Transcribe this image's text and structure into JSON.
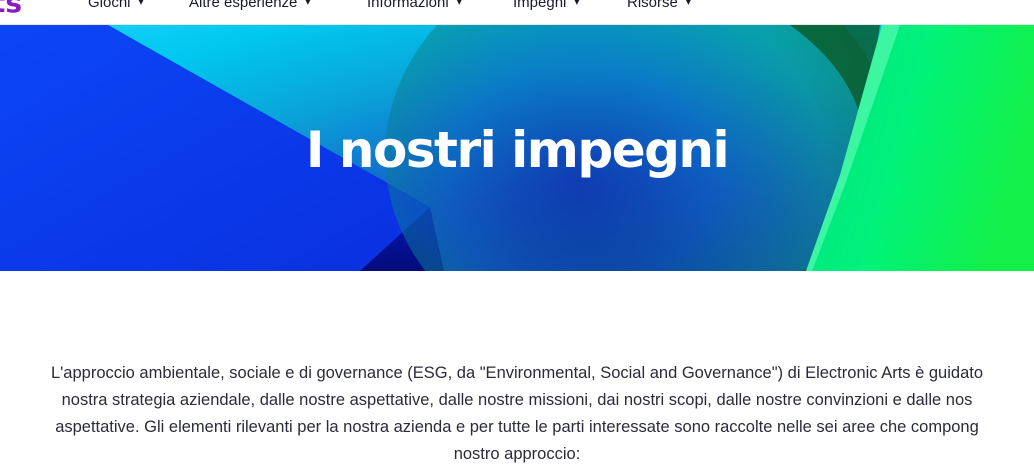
{
  "nav": {
    "logo_text": "ts",
    "items": [
      {
        "label": "Giochi"
      },
      {
        "label": "Altre esperienze"
      },
      {
        "label": "Informazioni"
      },
      {
        "label": "Impegni"
      },
      {
        "label": "Risorse"
      }
    ]
  },
  "hero": {
    "title": "I nostri impegni"
  },
  "intro": {
    "lines": [
      "L'approccio ambientale, sociale e di governance (ESG, da \"Environmental, Social and Governance\") di Electronic Arts è guidato",
      "nostra strategia aziendale, dalle nostre aspettative, dalle nostre missioni, dai nostri scopi, dalle nostre convinzioni e dalle nos",
      "aspettative. Gli elementi rilevanti per la nostra azienda e per tutte le parti interessate sono raccolte nelle sei aree che compong",
      "nostro approccio:"
    ]
  },
  "colors": {
    "brand_purple": "#8a1bc4",
    "hero_blue": "#0a3cf0",
    "hero_cyan": "#00c8ee",
    "hero_green": "#00f07a"
  }
}
